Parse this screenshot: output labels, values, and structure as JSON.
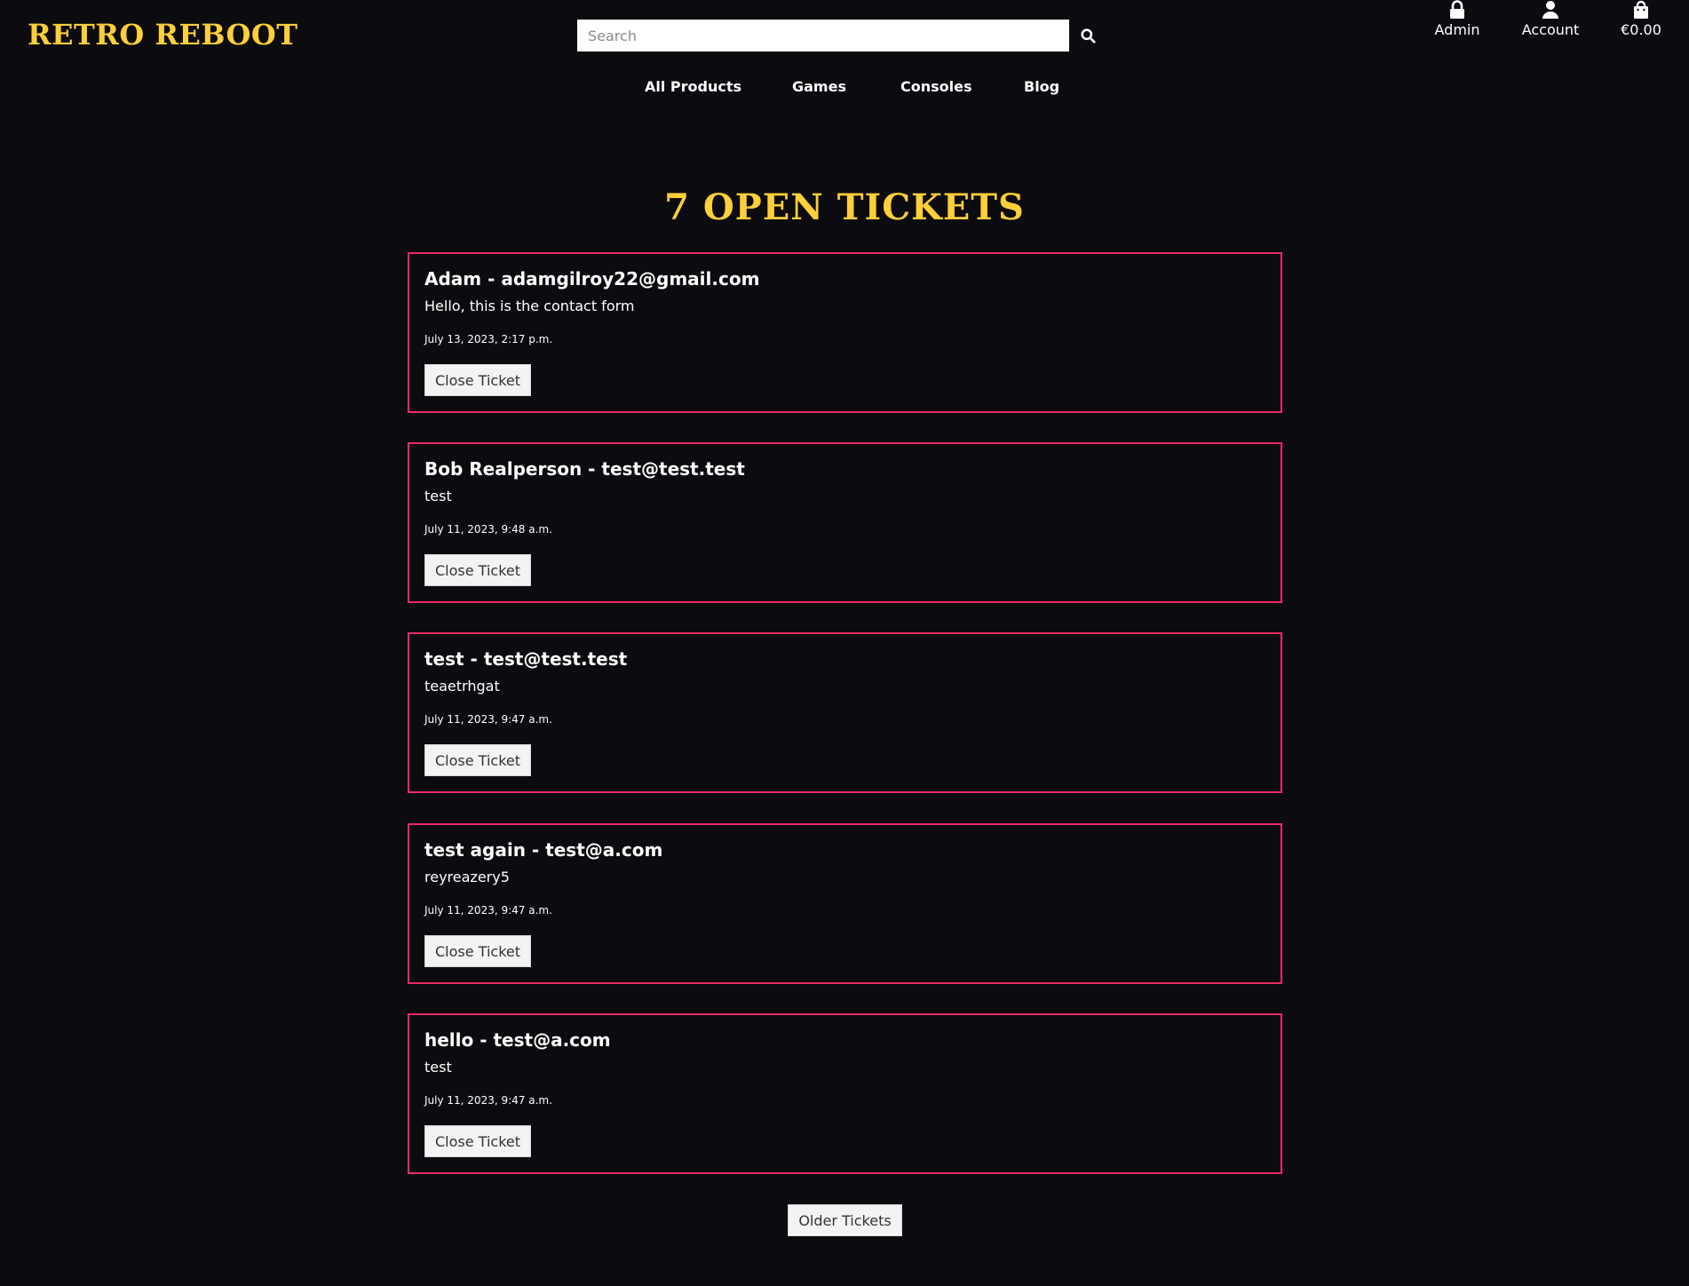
{
  "header": {
    "logo": "RETRO REBOOT",
    "search_placeholder": "Search",
    "links": {
      "admin": "Admin",
      "account": "Account",
      "cart": "€0.00"
    }
  },
  "nav": {
    "items": [
      "All Products",
      "Games",
      "Consoles",
      "Blog"
    ]
  },
  "main": {
    "title": "7 OPEN TICKETS",
    "close_label": "Close Ticket",
    "older_label": "Older Tickets",
    "tickets": [
      {
        "header": "Adam - adamgilroy22@gmail.com",
        "message": "Hello, this is the contact form",
        "date": "July 13, 2023, 2:17 p.m."
      },
      {
        "header": "Bob Realperson - test@test.test",
        "message": "test",
        "date": "July 11, 2023, 9:48 a.m."
      },
      {
        "header": "test - test@test.test",
        "message": "teaetrhgat",
        "date": "July 11, 2023, 9:47 a.m."
      },
      {
        "header": "test again - test@a.com",
        "message": "reyreazery5",
        "date": "July 11, 2023, 9:47 a.m."
      },
      {
        "header": "hello - test@a.com",
        "message": "test",
        "date": "July 11, 2023, 9:47 a.m."
      }
    ]
  },
  "colors": {
    "background": "#0c0c10",
    "accent_yellow": "#ffcf3a",
    "ticket_border": "#ec2a66"
  }
}
